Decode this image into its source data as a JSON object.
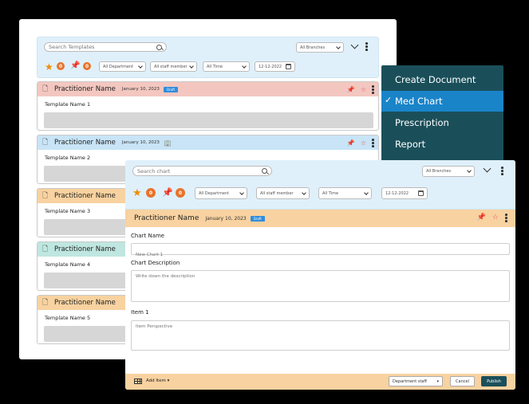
{
  "back": {
    "search_placeholder": "Search Templates",
    "branches": "All Branches",
    "favorites_count": "0",
    "pinned_count": "0",
    "department": "All Department",
    "staff": "All staff member",
    "time": "All Time",
    "date": "12-12-2022",
    "cards": [
      {
        "practitioner": "Practitioner Name",
        "date": "January 10, 2023",
        "status": "Draft",
        "template": "Template Name 1",
        "color": "#f3c7c0"
      },
      {
        "practitioner": "Practitioner Name",
        "date": "January 10, 2023",
        "template": "Template Name 2",
        "color": "#c8e4f6"
      },
      {
        "practitioner": "Practitioner Name",
        "template": "Template Name 3",
        "color": "#f8d2a0"
      },
      {
        "practitioner": "Practitioner Name",
        "template": "Template Name 4",
        "color": "#bfe6e0"
      },
      {
        "practitioner": "Practitioner Name",
        "template": "Template Name 5",
        "color": "#f8d2a0"
      }
    ]
  },
  "menu": {
    "items": [
      "Create Document",
      "Med Chart",
      "Prescription",
      "Report"
    ],
    "selected": "Med Chart",
    "check": "✓"
  },
  "front": {
    "search_placeholder": "Search chart",
    "branches": "All Branches",
    "favorites_count": "0",
    "pinned_count": "0",
    "department": "All Department",
    "staff": "All staff member",
    "time": "All Time",
    "date": "12-12-2022",
    "practitioner": "Practitioner Name",
    "record_date": "January 10, 2023",
    "status": "Draft",
    "chart_name_label": "Chart Name",
    "chart_name_placeholder": "New Chart 1",
    "chart_desc_label": "Chart Description",
    "chart_desc_placeholder": "Write down the description",
    "item_label": "Item 1",
    "item_placeholder": "Item Perspective",
    "add_item": "Add Item",
    "department_staff": "Department staff",
    "cancel": "Cancel",
    "publish": "Publish"
  },
  "colors": {
    "accent": "#1a4f5a",
    "menu_active": "#1a84c9",
    "badge": "#e8732a",
    "star": "#f08c00"
  }
}
